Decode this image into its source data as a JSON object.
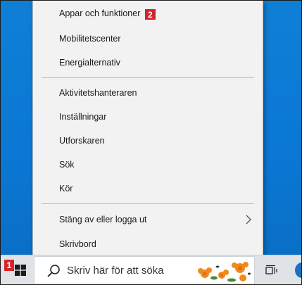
{
  "context_menu": {
    "items": [
      {
        "label": "Appar och funktioner",
        "badge": "2"
      },
      {
        "label": "Mobilitetscenter"
      },
      {
        "label": "Energialternativ"
      },
      {
        "label": "Aktivitetshanteraren"
      },
      {
        "label": "Inställningar"
      },
      {
        "label": "Utforskaren"
      },
      {
        "label": "Sök"
      },
      {
        "label": "Kör"
      },
      {
        "label": "Stäng av eller logga ut",
        "submenu": true
      },
      {
        "label": "Skrivbord"
      }
    ]
  },
  "taskbar": {
    "start_badge": "1",
    "search_placeholder": "Skriv här för att söka",
    "start_icon": "windows-logo-icon",
    "search_icon": "magnifier-icon",
    "task_view_icon": "task-view-icon"
  },
  "colors": {
    "desktop": "#0a78d4",
    "menu_bg": "#f2f2f2",
    "badge": "#d4252a",
    "taskbar": "#dfe3e7"
  }
}
